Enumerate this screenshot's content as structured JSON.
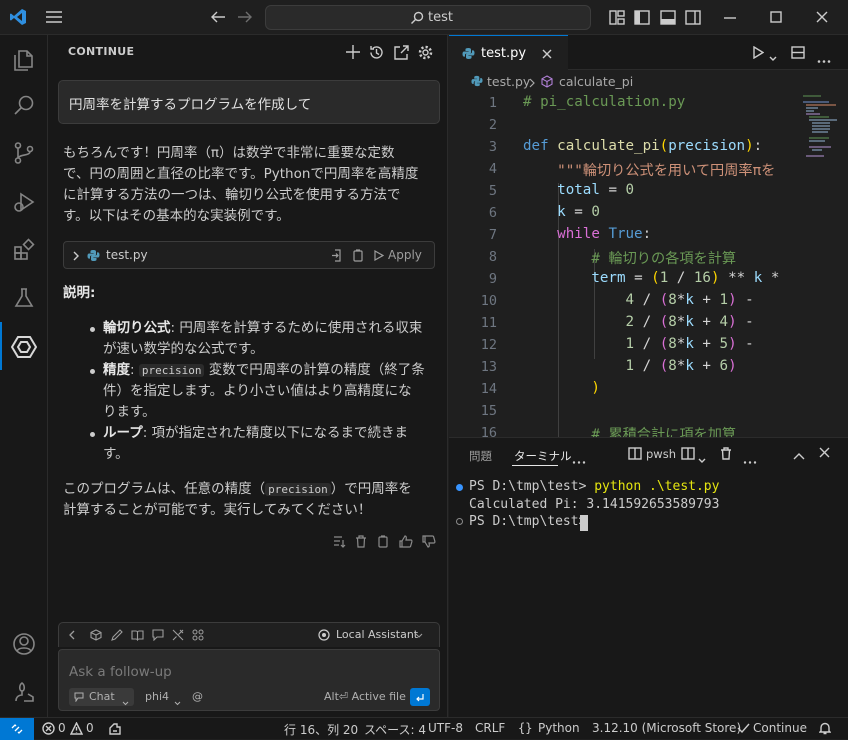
{
  "title_bar": {
    "search_text": "test"
  },
  "sidebar": {
    "title": "CONTINUE"
  },
  "chat": {
    "user_message": "円周率を計算するプログラムを作成して",
    "reply_lines": [
      "もちろんです！円周率（π）は数学で非常に重要な定数",
      "で、円の周囲と直径の比率です。Pythonで円周率を高精度",
      "に計算する方法の一つは、輪切り公式を使用する方法で",
      "す。以下はその基本的な実装例です。"
    ],
    "code_block": {
      "filename": "test.py",
      "apply_label": "Apply"
    },
    "explain_title": "説明:",
    "bullets": [
      {
        "term": "輪切り公式",
        "rest1": ": 円周率を計算するために使用される収束",
        "rest2": "が速い数学的な公式です。"
      },
      {
        "term": "精度",
        "pre": ": ",
        "code": "precision",
        "rest1": " 変数で円周率の計算の精度（終了条",
        "rest2": "件）を指定します。より小さい値はより高精度にな",
        "rest3": "ります。"
      },
      {
        "term": "ループ",
        "rest1": ": 項が指定された精度以下になるまで続きま",
        "rest2": "す。"
      }
    ],
    "closing_a": "このプログラムは、任意の精度（",
    "closing_code": "precision",
    "closing_b": "）で円周率を",
    "closing_c": "計算することが可能です。実行してみてください！"
  },
  "input": {
    "placeholder": "Ask a follow-up",
    "chat_mode": "Chat",
    "model": "phi4",
    "at": "@",
    "hint": "Alt⏎ Active file",
    "assistant": "Local Assistant"
  },
  "editor": {
    "tab": "test.py",
    "breadcrumb_file": "test.py",
    "breadcrumb_symbol": "calculate_pi",
    "line_numbers": [
      "1",
      "2",
      "3",
      "4",
      "5",
      "6",
      "7",
      "8",
      "9",
      "10",
      "11",
      "12",
      "13",
      "14",
      "15",
      "16"
    ]
  },
  "terminal": {
    "tab_problems": "問題",
    "tab_terminal": "ターミナル",
    "shell": "pwsh",
    "line1_prompt": "PS D:\\tmp\\test> ",
    "line1_cmd": "python .\\test.py",
    "line2": "Calculated Pi: 3.141592653589793",
    "line3": "PS D:\\tmp\\test> "
  },
  "status": {
    "errors": "0",
    "warnings": "0",
    "position": "行 16、列 20",
    "spaces": "スペース: 4",
    "encoding": "UTF-8",
    "eol": "CRLF",
    "language": "Python",
    "interpreter": "3.12.10 (Microsoft Store)",
    "continue": "Continue"
  },
  "colors": {
    "accent": "#0078d4",
    "keyword": "#569cd6",
    "function": "#dcdcaa",
    "string": "#ce9178",
    "comment": "#6a9955"
  }
}
